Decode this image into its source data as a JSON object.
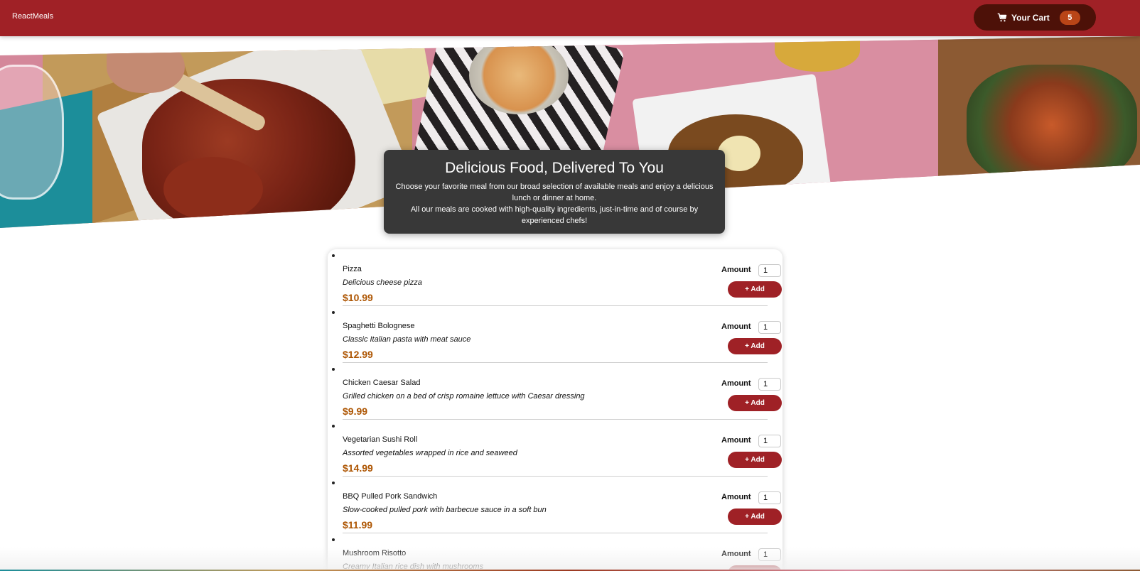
{
  "header": {
    "brand": "ReactMeals",
    "cart_label": "Your Cart",
    "cart_count": "5",
    "accent_color": "#a02126",
    "cart_button_color": "#4d1108",
    "badge_color": "#b94517",
    "cart_icon": "cart-icon"
  },
  "summary": {
    "title": "Delicious Food, Delivered To You",
    "line1": "Choose your favorite meal from our broad selection of available meals and enjoy a delicious lunch or dinner at home.",
    "line2": "All our meals are cooked with high-quality ingredients, just-in-time and of course by experienced chefs!"
  },
  "meals": {
    "amount_label": "Amount",
    "add_label": "+ Add",
    "price_color": "#ad5502",
    "items": [
      {
        "name": "Pizza",
        "description": "Delicious cheese pizza",
        "price": "$10.99",
        "amount": "1"
      },
      {
        "name": "Spaghetti Bolognese",
        "description": "Classic Italian pasta with meat sauce",
        "price": "$12.99",
        "amount": "1"
      },
      {
        "name": "Chicken Caesar Salad",
        "description": "Grilled chicken on a bed of crisp romaine lettuce with Caesar dressing",
        "price": "$9.99",
        "amount": "1"
      },
      {
        "name": "Vegetarian Sushi Roll",
        "description": "Assorted vegetables wrapped in rice and seaweed",
        "price": "$14.99",
        "amount": "1"
      },
      {
        "name": "BBQ Pulled Pork Sandwich",
        "description": "Slow-cooked pulled pork with barbecue sauce in a soft bun",
        "price": "$11.99",
        "amount": "1"
      },
      {
        "name": "Mushroom Risotto",
        "description": "Creamy Italian rice dish with mushrooms",
        "price": "",
        "amount": "1"
      }
    ]
  }
}
